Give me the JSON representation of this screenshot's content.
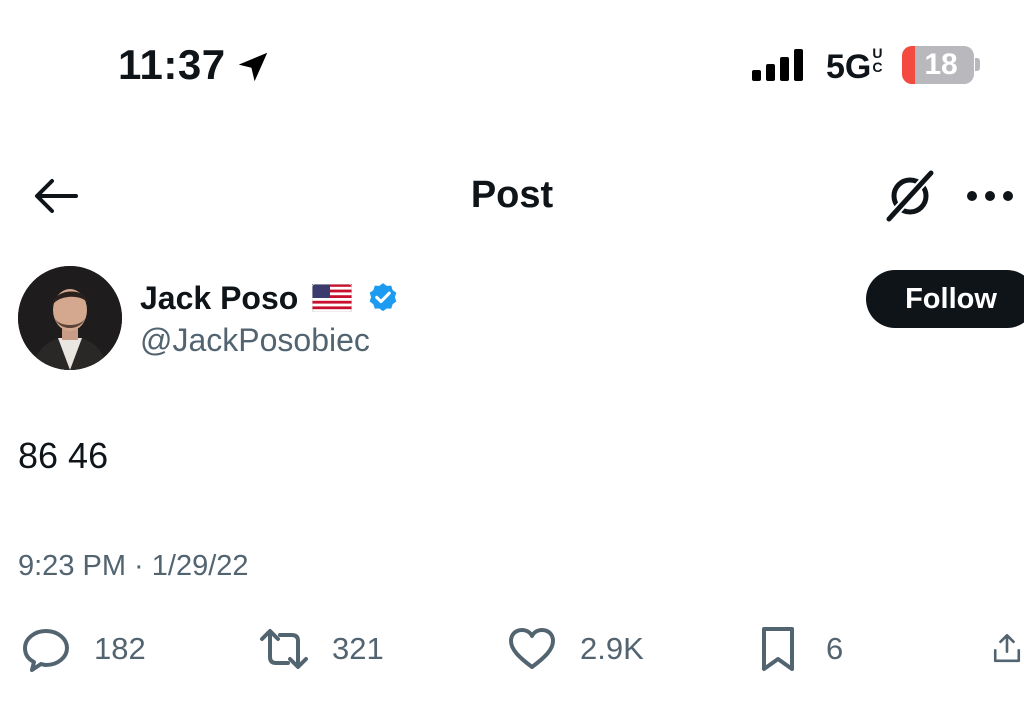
{
  "status_bar": {
    "time": "11:37",
    "network": "5G",
    "network_suffix": "UC",
    "battery_level": "18",
    "battery_fraction": 0.18,
    "location_icon": "location-arrow-icon",
    "signal_icon": "cell-signal-icon"
  },
  "header": {
    "title": "Post",
    "back_icon": "arrow-left-icon",
    "grok_icon": "grok-icon",
    "more_icon": "ellipsis-icon"
  },
  "author": {
    "display_name": "Jack Poso",
    "handle": "@JackPosobiec",
    "flag_icon": "us-flag-icon",
    "verified_icon": "verified-badge-icon",
    "follow_label": "Follow"
  },
  "post": {
    "text": "86 46",
    "timestamp": "9:23 PM · 1/29/22"
  },
  "actions": {
    "replies": "182",
    "reposts": "321",
    "likes": "2.9K",
    "bookmarks": "6"
  },
  "colors": {
    "text": "#0f1419",
    "secondary": "#536471",
    "verified": "#1d9bf0",
    "battery_low": "#f34b3f",
    "follow_bg": "#0f1419"
  }
}
